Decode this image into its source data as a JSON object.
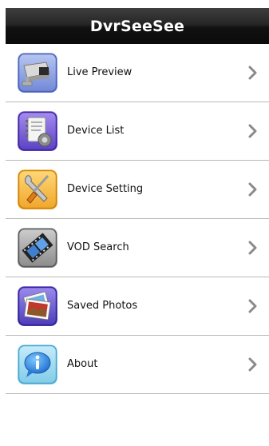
{
  "app": {
    "title": "DvrSeeSee"
  },
  "menu": {
    "items": [
      {
        "label": "Live Preview",
        "icon": "camera-icon"
      },
      {
        "label": "Device List",
        "icon": "device-list-icon"
      },
      {
        "label": "Device Setting",
        "icon": "tools-icon"
      },
      {
        "label": "VOD Search",
        "icon": "film-icon"
      },
      {
        "label": "Saved Photos",
        "icon": "photos-icon"
      },
      {
        "label": "About",
        "icon": "info-icon"
      }
    ]
  },
  "colors": {
    "titlebar": "#1a1a1a",
    "title_text": "#ffffff",
    "divider": "#b8b8b8",
    "chevron": "#8a8a8a"
  }
}
